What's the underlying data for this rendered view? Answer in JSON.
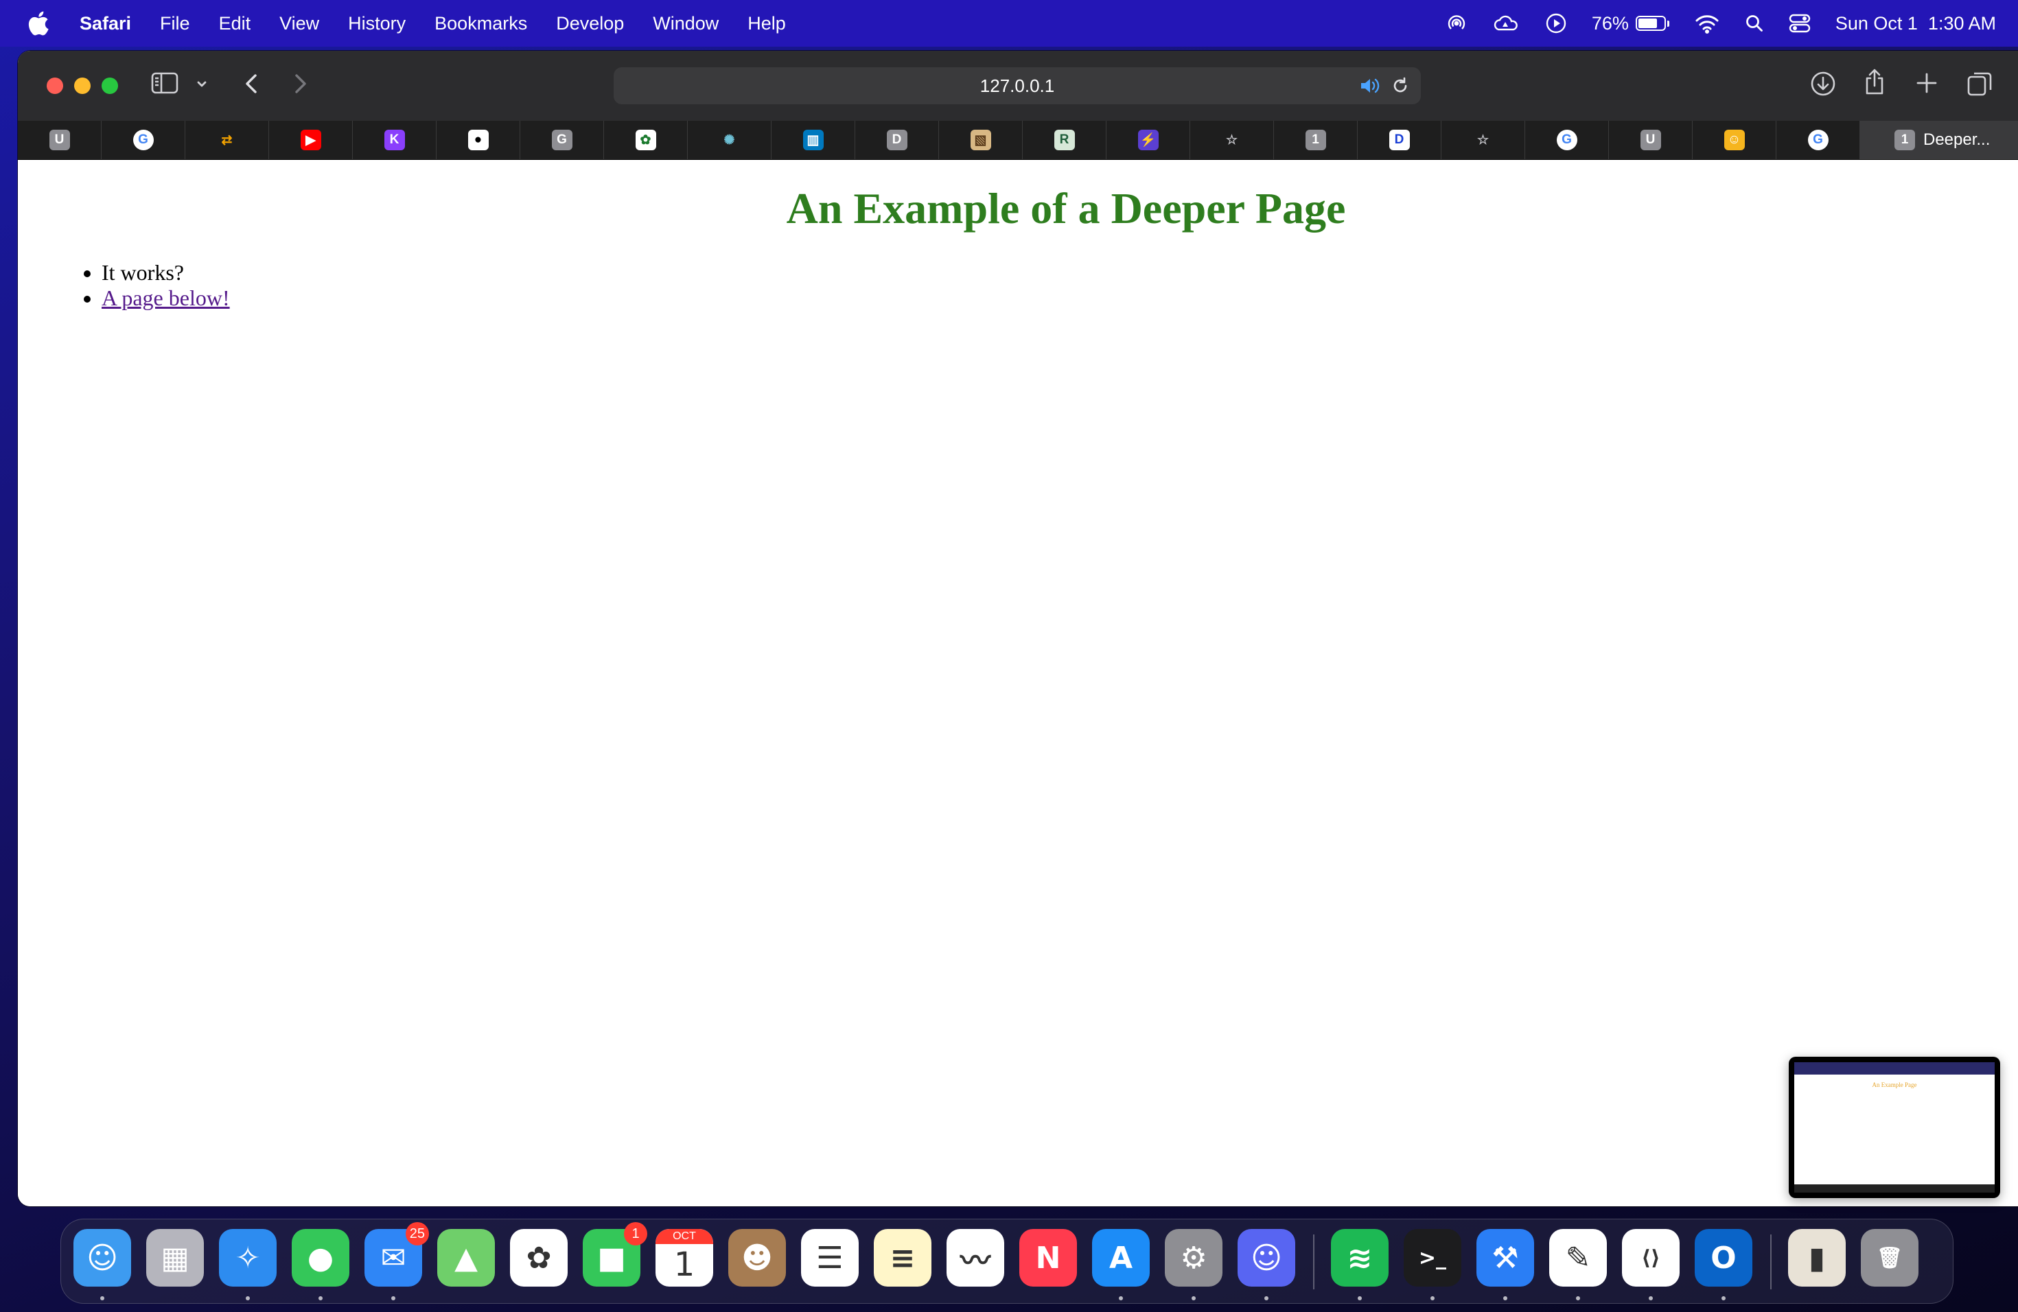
{
  "menubar": {
    "app_name": "Safari",
    "items": [
      "File",
      "Edit",
      "View",
      "History",
      "Bookmarks",
      "Develop",
      "Window",
      "Help"
    ],
    "battery_percent": "76%",
    "battery_level": 0.76,
    "clock": "Sun Oct 1  1:30 AM",
    "status_icons": [
      "airdrop-icon",
      "weather-icon",
      "now-playing-icon",
      "battery-icon",
      "wifi-icon",
      "spotlight-search-icon",
      "control-center-icon"
    ]
  },
  "browser": {
    "url": "127.0.0.1",
    "tabs": [
      {
        "icon": "u-favicon",
        "letter": "U",
        "color": "#8e8e93"
      },
      {
        "icon": "google-favicon",
        "letter": "G",
        "color": "#ffffff",
        "text_color": "#4285f4"
      },
      {
        "icon": "arrows-favicon",
        "letter": "⇄",
        "color": "#1e1e1e",
        "text_color": "#f4a300"
      },
      {
        "icon": "youtube-favicon",
        "letter": "▶",
        "color": "#ff0000"
      },
      {
        "icon": "k-favicon",
        "letter": "K",
        "color": "#8a3ffc"
      },
      {
        "icon": "github-favicon",
        "letter": "●",
        "color": "#ffffff",
        "text_color": "#000000"
      },
      {
        "icon": "g-gray-favicon",
        "letter": "G",
        "color": "#8e8e93"
      },
      {
        "icon": "leaf-favicon",
        "letter": "✿",
        "color": "#ffffff",
        "text_color": "#1b7a2e"
      },
      {
        "icon": "spinner-favicon",
        "letter": "✺",
        "color": "#1e1e1e",
        "text_color": "#6ec1d6"
      },
      {
        "icon": "trello-favicon",
        "letter": "▥",
        "color": "#0079bf"
      },
      {
        "icon": "d-favicon",
        "letter": "D",
        "color": "#8e8e93"
      },
      {
        "icon": "map-favicon",
        "letter": "▧",
        "color": "#d8b884",
        "text_color": "#5a3b1a"
      },
      {
        "icon": "r-favicon",
        "letter": "R",
        "color": "#d7e8d8",
        "text_color": "#1f5f3a"
      },
      {
        "icon": "bolt-favicon",
        "letter": "⚡",
        "color": "#5b3fd1"
      },
      {
        "icon": "star-favicon",
        "letter": "☆",
        "color": "#1e1e1e",
        "text_color": "#c7c7cc"
      },
      {
        "icon": "one-favicon",
        "letter": "1",
        "color": "#8e8e93"
      },
      {
        "icon": "disney-favicon",
        "letter": "D",
        "color": "#ffffff",
        "text_color": "#1a3fd6"
      },
      {
        "icon": "star-favicon",
        "letter": "☆",
        "color": "#1e1e1e",
        "text_color": "#c7c7cc"
      },
      {
        "icon": "google-favicon",
        "letter": "G",
        "color": "#ffffff",
        "text_color": "#4285f4"
      },
      {
        "icon": "u-favicon",
        "letter": "U",
        "color": "#8e8e93"
      },
      {
        "icon": "yellow-favicon",
        "letter": "☺",
        "color": "#f6b51e"
      },
      {
        "icon": "google-favicon",
        "letter": "G",
        "color": "#ffffff",
        "text_color": "#4285f4"
      }
    ],
    "active_tab": {
      "favicon_letter": "1",
      "label": "Deeper..."
    }
  },
  "page": {
    "heading": "An Example of a Deeper Page",
    "heading_color": "#2e7d1e",
    "list": [
      {
        "text": "It works?",
        "is_link": false
      },
      {
        "text": "A page below!",
        "is_link": true
      }
    ],
    "thumbnail_title": "An Example Page"
  },
  "dock": {
    "apps": [
      {
        "name": "finder-icon",
        "color": "#3d9bf0",
        "glyph": "☺",
        "dot": true
      },
      {
        "name": "launchpad-icon",
        "color": "#b5b5bd",
        "glyph": "▦",
        "dot": false
      },
      {
        "name": "safari-icon",
        "color": "#2d8cf0",
        "glyph": "✧",
        "dot": true
      },
      {
        "name": "messages-icon",
        "color": "#34c759",
        "glyph": "●",
        "dot": true
      },
      {
        "name": "mail-icon",
        "color": "#2f86f6",
        "glyph": "✉",
        "dot": true,
        "badge": "25"
      },
      {
        "name": "maps-icon",
        "color": "#6fcf6a",
        "glyph": "▲",
        "dot": false
      },
      {
        "name": "photos-icon",
        "color": "#ffffff",
        "glyph": "✿",
        "dot": false
      },
      {
        "name": "facetime-icon",
        "color": "#34c759",
        "glyph": "■",
        "dot": false,
        "badge": "1"
      },
      {
        "name": "calendar-icon",
        "color": "#ffffff",
        "glyph": "1",
        "dot": false,
        "month": "OCT"
      },
      {
        "name": "contacts-icon",
        "color": "#a67c52",
        "glyph": "☻",
        "dot": false
      },
      {
        "name": "reminders-icon",
        "color": "#ffffff",
        "glyph": "☰",
        "dot": false
      },
      {
        "name": "notes-icon",
        "color": "#fff6c9",
        "glyph": "≡",
        "dot": false
      },
      {
        "name": "freeform-icon",
        "color": "#ffffff",
        "glyph": "〰",
        "dot": false
      },
      {
        "name": "news-icon",
        "color": "#ff3b4e",
        "glyph": "N",
        "dot": false
      },
      {
        "name": "app-store-icon",
        "color": "#1c8cf7",
        "glyph": "A",
        "dot": true
      },
      {
        "name": "system-settings-icon",
        "color": "#8e8e93",
        "glyph": "⚙",
        "dot": true
      },
      {
        "name": "discord-icon",
        "color": "#5865f2",
        "glyph": "☺",
        "dot": true
      },
      {
        "name": "spotify-icon",
        "color": "#1db954",
        "glyph": "≋",
        "dot": true
      },
      {
        "name": "terminal-icon",
        "color": "#1c1c1e",
        "glyph": ">_",
        "dot": true
      },
      {
        "name": "xcode-icon",
        "color": "#2a7ef5",
        "glyph": "⚒",
        "dot": true
      },
      {
        "name": "textedit-icon",
        "color": "#ffffff",
        "glyph": "✎",
        "dot": true
      },
      {
        "name": "vscode-icon",
        "color": "#ffffff",
        "glyph": "⟨⟩",
        "dot": true
      },
      {
        "name": "outlook-icon",
        "color": "#0a64c8",
        "glyph": "O",
        "dot": true
      },
      {
        "name": "recent-document-icon",
        "color": "#e8e2d6",
        "glyph": "▮",
        "dot": false
      },
      {
        "name": "trash-icon",
        "color": "#8f8f94",
        "glyph": "🗑",
        "dot": false
      }
    ]
  }
}
